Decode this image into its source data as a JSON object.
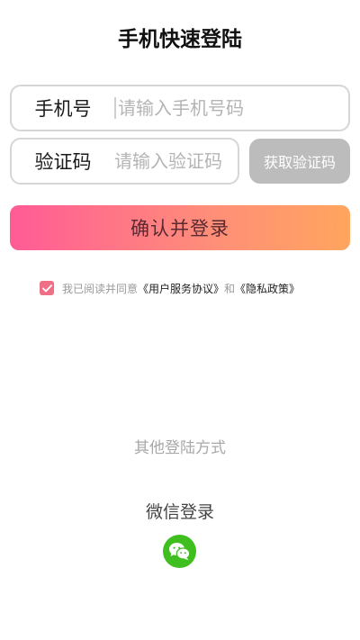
{
  "header": {
    "title": "手机快速登陆"
  },
  "form": {
    "phone_label": "手机号",
    "phone_placeholder": "请输入手机号码",
    "code_label": "验证码",
    "code_placeholder": "请输入验证码",
    "get_code_label": "获取验证码",
    "confirm_label": "确认并登录"
  },
  "agreement": {
    "prefix": "我已阅读并同意",
    "user_agreement": "《用户服务协议》",
    "and": "和",
    "privacy_policy": "《隐私政策》",
    "checked": true
  },
  "other": {
    "title": "其他登陆方式",
    "wechat_label": "微信登录"
  },
  "colors": {
    "gradient_start": "#ff5b96",
    "gradient_end": "#ffa55e",
    "checkbox": "#ee6f86",
    "wechat_green": "#3fbf1f",
    "disabled_button": "#bcbcbc"
  },
  "icons": {
    "checkbox": "checkmark-icon",
    "wechat": "wechat-icon"
  }
}
